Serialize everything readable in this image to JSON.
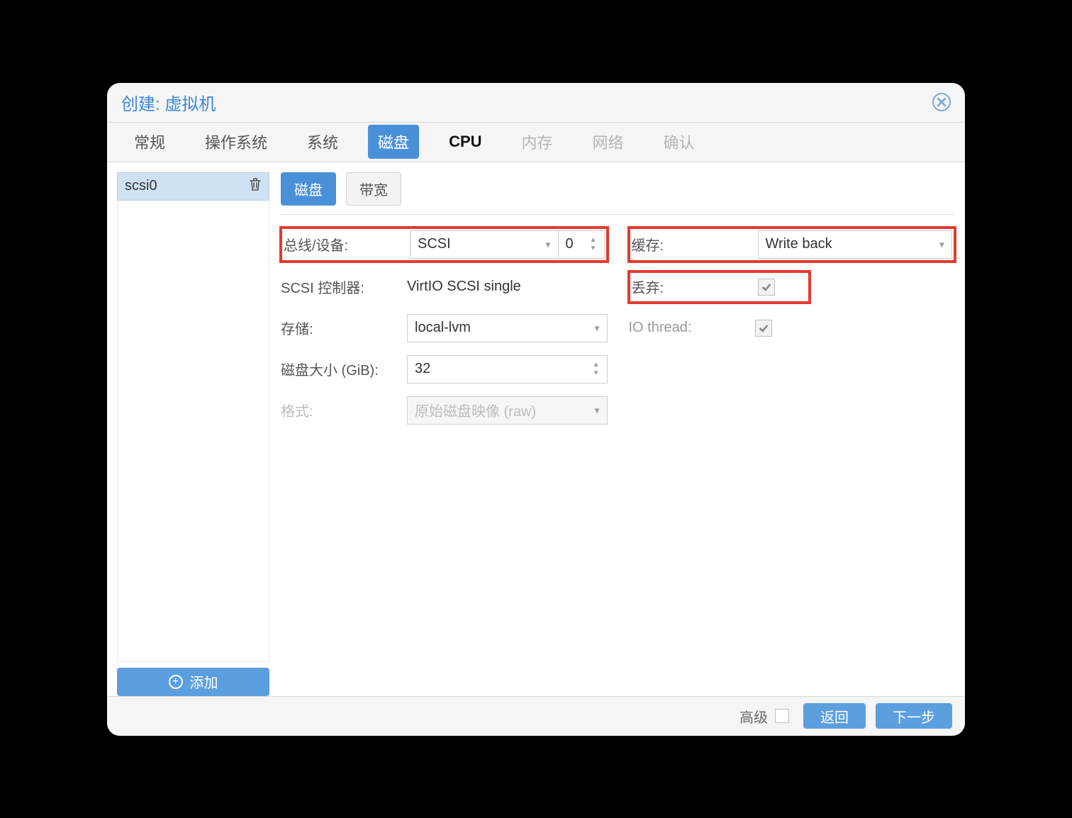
{
  "window": {
    "title": "创建: 虚拟机"
  },
  "tabs": {
    "general": "常规",
    "os": "操作系统",
    "system": "系统",
    "disk": "磁盘",
    "cpu": "CPU",
    "memory": "内存",
    "network": "网络",
    "confirm": "确认"
  },
  "sidebar": {
    "disk0": "scsi0",
    "add": "添加"
  },
  "subtabs": {
    "disk": "磁盘",
    "bandwidth": "带宽"
  },
  "form": {
    "left": {
      "bus_label": "总线/设备:",
      "bus_value": "SCSI",
      "bus_index": "0",
      "scsi_ctrl_label": "SCSI 控制器:",
      "scsi_ctrl_value": "VirtIO SCSI single",
      "storage_label": "存储:",
      "storage_value": "local-lvm",
      "size_label": "磁盘大小 (GiB):",
      "size_value": "32",
      "format_label": "格式:",
      "format_value": "原始磁盘映像 (raw)"
    },
    "right": {
      "cache_label": "缓存:",
      "cache_value": "Write back",
      "discard_label": "丢弃:",
      "iothread_label": "IO thread:"
    }
  },
  "footer": {
    "advanced": "高级",
    "back": "返回",
    "next": "下一步"
  }
}
